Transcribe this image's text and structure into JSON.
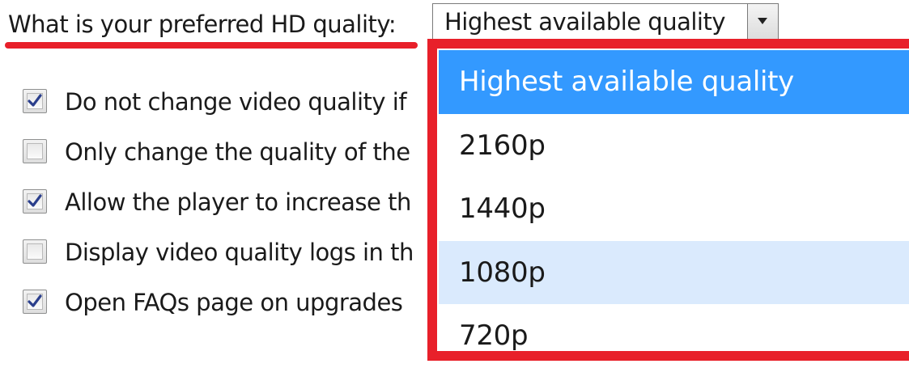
{
  "accent": {
    "annotation_red": "#e8202a",
    "selected_blue": "#3399ff",
    "hover_blue": "#daeafd"
  },
  "quality": {
    "question_label": "What is your preferred HD quality:",
    "selected_value": "Highest available quality",
    "arrow_icon": "chevron-down-icon",
    "options": [
      {
        "label": "Highest available quality",
        "state": "selected"
      },
      {
        "label": "2160p",
        "state": "normal"
      },
      {
        "label": "1440p",
        "state": "normal"
      },
      {
        "label": "1080p",
        "state": "hovered"
      },
      {
        "label": "720p",
        "state": "normal"
      }
    ]
  },
  "settings": [
    {
      "label": "Do not change video quality if",
      "checked": true
    },
    {
      "label": "Only change the quality of the",
      "checked": false
    },
    {
      "label": "Allow the player to increase th",
      "checked": true
    },
    {
      "label": "Display video quality logs in th",
      "checked": false
    },
    {
      "label": "Open FAQs page on upgrades",
      "checked": true
    }
  ]
}
